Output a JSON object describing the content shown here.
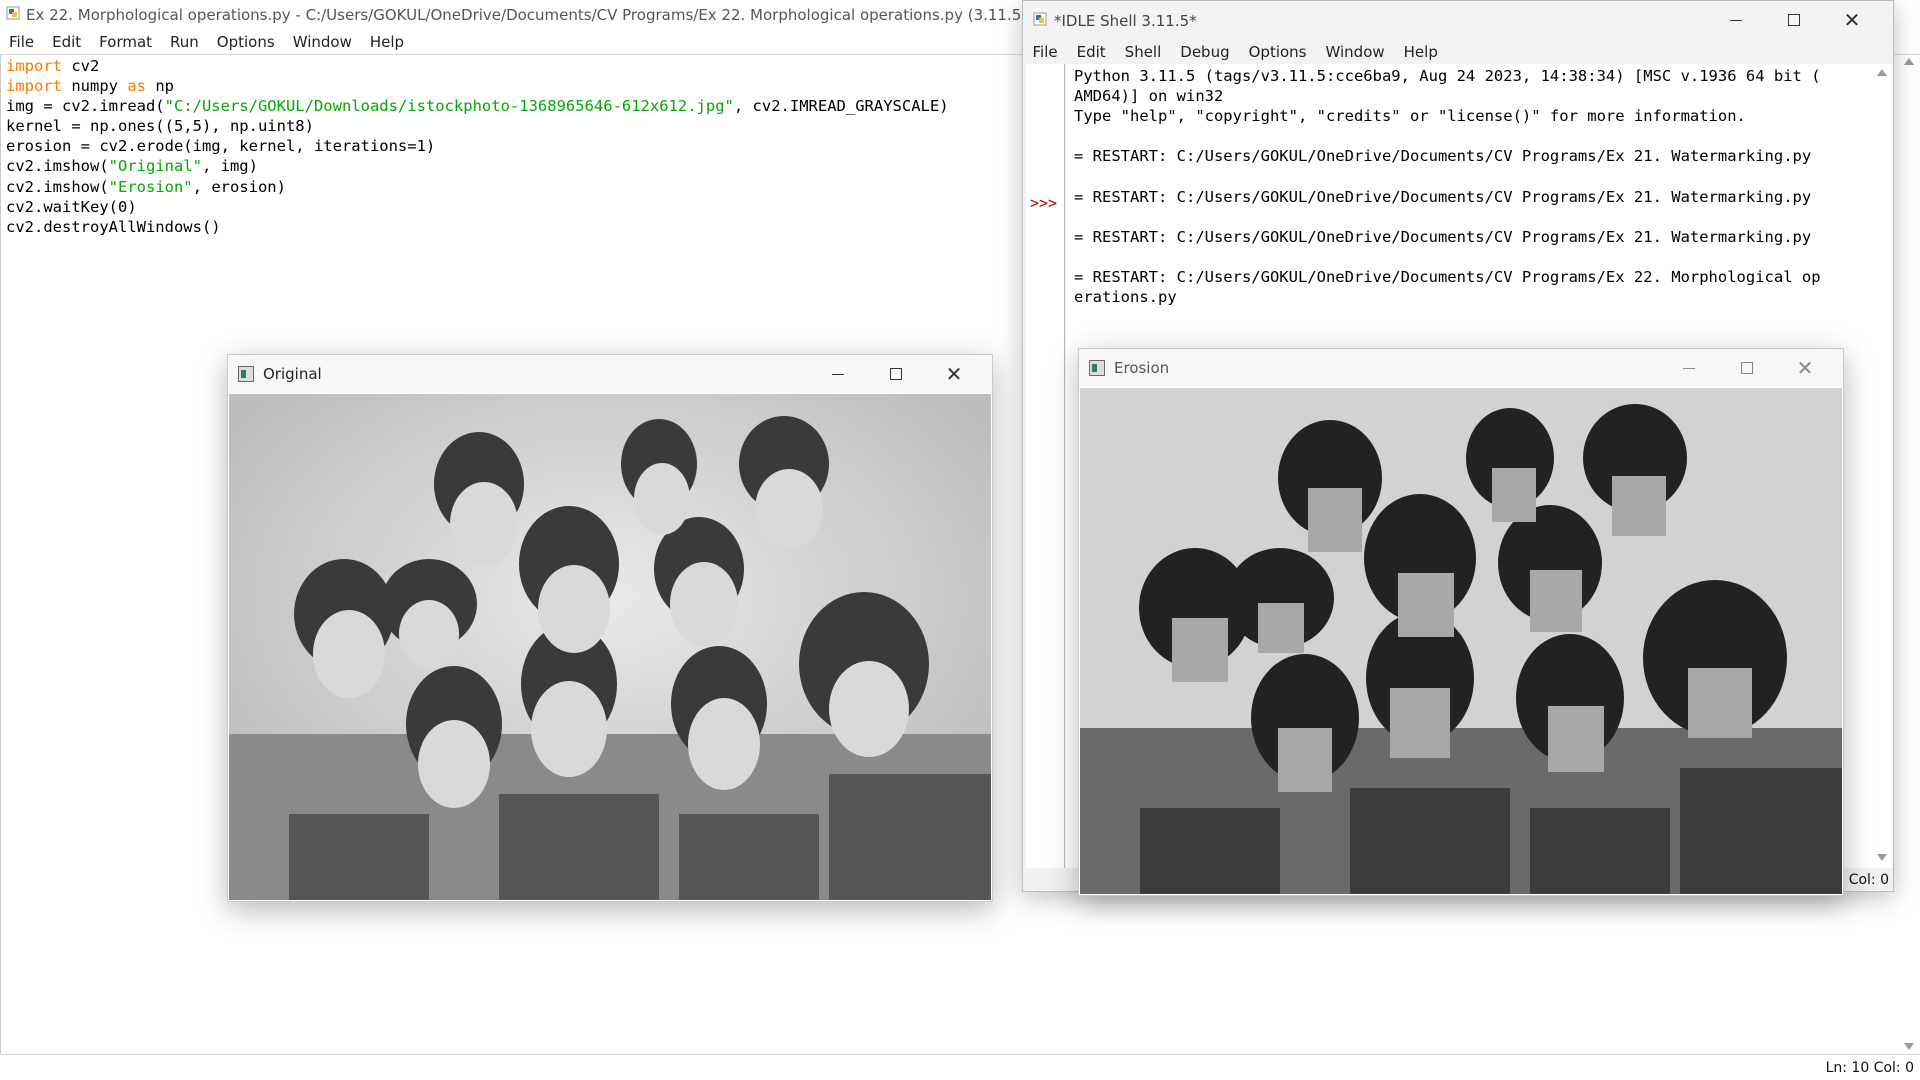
{
  "editor": {
    "title": "Ex 22. Morphological operations.py - C:/Users/GOKUL/OneDrive/Documents/CV Programs/Ex 22. Morphological operations.py (3.11.5)",
    "menu": [
      "File",
      "Edit",
      "Format",
      "Run",
      "Options",
      "Window",
      "Help"
    ],
    "code": [
      [
        [
          "kw",
          "import"
        ],
        [
          "t",
          " cv2"
        ]
      ],
      [
        [
          "kw",
          "import"
        ],
        [
          "t",
          " numpy "
        ],
        [
          "kw",
          "as"
        ],
        [
          "t",
          " np"
        ]
      ],
      [
        [
          "t",
          "img = cv2.imread("
        ],
        [
          "st",
          "\"C:/Users/GOKUL/Downloads/istockphoto-1368965646-612x612.jpg\""
        ],
        [
          "t",
          ", cv2.IMREAD_GRAYSCALE)"
        ]
      ],
      [
        [
          "t",
          "kernel = np.ones((5,5), np.uint8)"
        ]
      ],
      [
        [
          "t",
          "erosion = cv2.erode(img, kernel, iterations=1)"
        ]
      ],
      [
        [
          "t",
          "cv2.imshow("
        ],
        [
          "st",
          "\"Original\""
        ],
        [
          "t",
          ", img)"
        ]
      ],
      [
        [
          "t",
          "cv2.imshow("
        ],
        [
          "st",
          "\"Erosion\""
        ],
        [
          "t",
          ", erosion)"
        ]
      ],
      [
        [
          "t",
          "cv2.waitKey(0)"
        ]
      ],
      [
        [
          "t",
          "cv2.destroyAllWindows()"
        ]
      ]
    ],
    "status": "Ln: 10   Col: 0"
  },
  "shell": {
    "title": "*IDLE Shell 3.11.5*",
    "menu": [
      "File",
      "Edit",
      "Shell",
      "Debug",
      "Options",
      "Window",
      "Help"
    ],
    "lines": [
      "Python 3.11.5 (tags/v3.11.5:cce6ba9, Aug 24 2023, 14:38:34) [MSC v.1936 64 bit (",
      "AMD64)] on win32",
      "Type \"help\", \"copyright\", \"credits\" or \"license()\" for more information.",
      "",
      "= RESTART: C:/Users/GOKUL/OneDrive/Documents/CV Programs/Ex 21. Watermarking.py",
      "",
      "= RESTART: C:/Users/GOKUL/OneDrive/Documents/CV Programs/Ex 21. Watermarking.py",
      "",
      "= RESTART: C:/Users/GOKUL/OneDrive/Documents/CV Programs/Ex 21. Watermarking.py",
      "",
      "= RESTART: C:/Users/GOKUL/OneDrive/Documents/CV Programs/Ex 22. Morphological op",
      "erations.py"
    ],
    "prompt": ">>>",
    "status": "Col: 0"
  },
  "original_window": {
    "title": "Original"
  },
  "erosion_window": {
    "title": "Erosion"
  }
}
